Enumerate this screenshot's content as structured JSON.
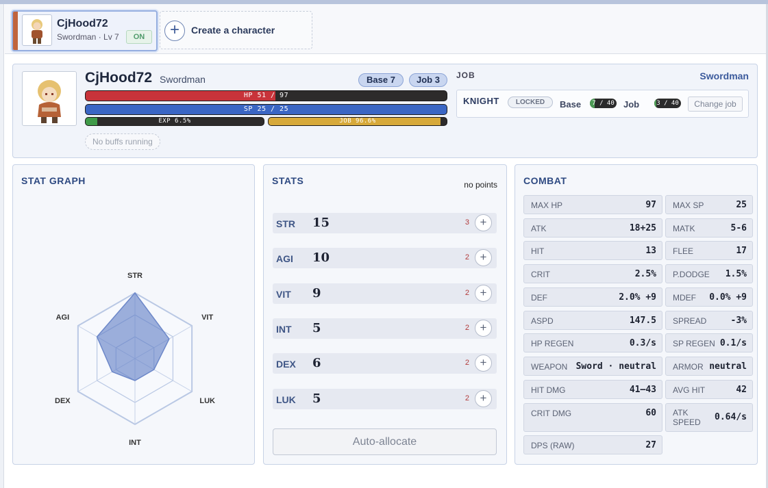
{
  "tabs": {
    "active": {
      "name": "CjHood72",
      "subtitle": "Swordman · Lv 7",
      "status": "ON"
    },
    "create_label": "Create a character"
  },
  "character": {
    "name": "CjHood72",
    "job": "Swordman",
    "base_badge": "Base 7",
    "job_badge": "Job 3",
    "hp_text": "HP 51 / 97",
    "hp_fraction": 0.526,
    "sp_text": "SP 25 / 25",
    "sp_fraction": 1.0,
    "exp_text": "EXP 6.5%",
    "exp_fraction": 0.065,
    "joblvl_text": "JOB 96.6%",
    "joblvl_fraction": 0.966,
    "buffs_text": "No buffs running"
  },
  "job_panel": {
    "title": "JOB",
    "current": "Swordman",
    "next_job": "KNIGHT",
    "locked_label": "LOCKED",
    "base_label": "Base",
    "base_progress": "7 / 40",
    "job_label": "Job",
    "job_progress": "3 / 40",
    "change_button": "Change job"
  },
  "stat_graph": {
    "title": "STAT GRAPH",
    "axes": [
      "STR",
      "VIT",
      "LUK",
      "INT",
      "DEX",
      "AGI"
    ],
    "values": [
      15,
      9,
      5,
      5,
      6,
      10
    ],
    "max": 15
  },
  "stats": {
    "title": "STATS",
    "points_text": "no points",
    "rows": [
      {
        "name": "STR",
        "value": "15",
        "cost": "3"
      },
      {
        "name": "AGI",
        "value": "10",
        "cost": "2"
      },
      {
        "name": "VIT",
        "value": "9",
        "cost": "2"
      },
      {
        "name": "INT",
        "value": "5",
        "cost": "2"
      },
      {
        "name": "DEX",
        "value": "6",
        "cost": "2"
      },
      {
        "name": "LUK",
        "value": "5",
        "cost": "2"
      }
    ],
    "plus_symbol": "+",
    "auto_allocate": "Auto-allocate"
  },
  "combat": {
    "title": "COMBAT",
    "left": [
      {
        "label": "MAX HP",
        "value": "97"
      },
      {
        "label": "ATK",
        "value": "18+25"
      },
      {
        "label": "HIT",
        "value": "13"
      },
      {
        "label": "CRIT",
        "value": "2.5%"
      },
      {
        "label": "DEF",
        "value": "2.0% +9"
      },
      {
        "label": "ASPD",
        "value": "147.5"
      },
      {
        "label": "HP REGEN",
        "value": "0.3/s"
      },
      {
        "label": "WEAPON",
        "value": "Sword · neutral"
      },
      {
        "label": "HIT DMG",
        "value": "41–43"
      },
      {
        "label": "CRIT DMG",
        "value": "60"
      },
      {
        "label": "DPS (RAW)",
        "value": "27"
      }
    ],
    "right": [
      {
        "label": "MAX SP",
        "value": "25"
      },
      {
        "label": "MATK",
        "value": "5-6"
      },
      {
        "label": "FLEE",
        "value": "17"
      },
      {
        "label": "P.DODGE",
        "value": "1.5%"
      },
      {
        "label": "MDEF",
        "value": "0.0% +9"
      },
      {
        "label": "SPREAD",
        "value": "-3%"
      },
      {
        "label": "SP REGEN",
        "value": "0.1/s"
      },
      {
        "label": "ARMOR",
        "value": "neutral"
      },
      {
        "label": "AVG HIT",
        "value": "42"
      },
      {
        "label": "ATK SPEED",
        "value": "0.64/s"
      }
    ]
  },
  "colors": {
    "hp": "#c8333a",
    "sp": "#3a66c4",
    "exp": "#3f9a48",
    "job": "#d7a93a",
    "accent": "#2e4a82"
  }
}
